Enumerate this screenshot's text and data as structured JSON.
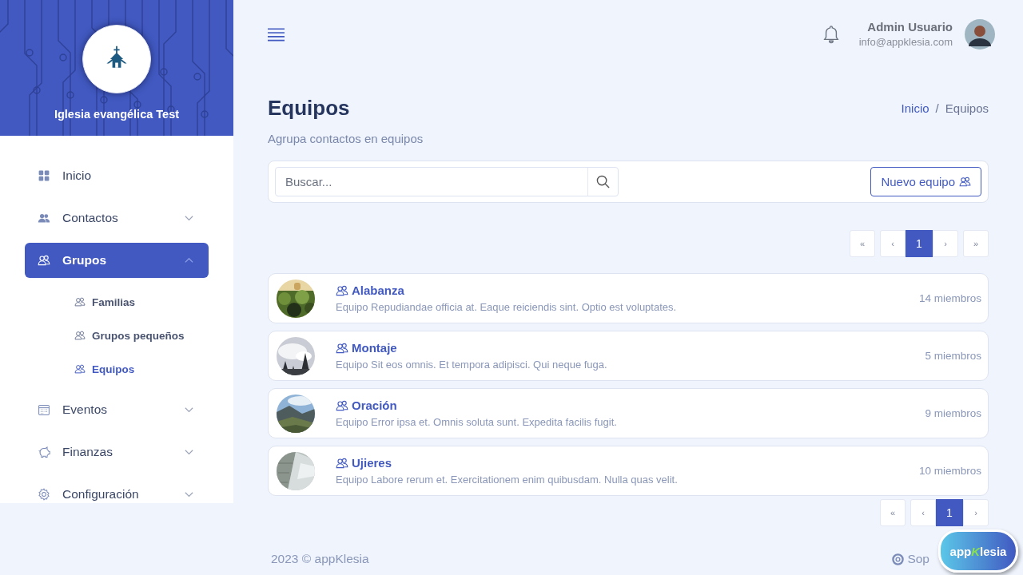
{
  "sidebar": {
    "church_name": "Iglesia evangélica Test",
    "items": [
      {
        "label": "Inicio",
        "selected": false
      },
      {
        "label": "Contactos",
        "selected": false,
        "expanded": false
      },
      {
        "label": "Grupos",
        "selected": true,
        "expanded": true,
        "children": [
          {
            "label": "Familias",
            "selected": false
          },
          {
            "label": "Grupos pequeños",
            "selected": false
          },
          {
            "label": "Equipos",
            "selected": true
          }
        ]
      },
      {
        "label": "Eventos",
        "selected": false,
        "expanded": false
      },
      {
        "label": "Finanzas",
        "selected": false,
        "expanded": false
      },
      {
        "label": "Configuración",
        "selected": false,
        "expanded": false
      }
    ]
  },
  "header": {
    "user_name": "Admin Usuario",
    "user_email": "info@appklesia.com"
  },
  "page": {
    "title": "Equipos",
    "subtitle": "Agrupa contactos en equipos",
    "breadcrumb": [
      {
        "label": "Inicio",
        "selected": false
      },
      {
        "label": "Equipos",
        "selected": true
      }
    ],
    "breadcrumb_separator": "/"
  },
  "search": {
    "placeholder": "Buscar..."
  },
  "new_button": "Nuevo equipo",
  "pagination_top": [
    {
      "label": "«",
      "selected": false
    },
    {
      "label": "‹",
      "selected": false
    },
    {
      "label": "1",
      "selected": true
    },
    {
      "label": "›",
      "selected": false
    },
    {
      "label": "»",
      "selected": false
    }
  ],
  "teams": [
    {
      "name": "Alabanza",
      "description": "Equipo Repudiandae officia at. Eaque reiciendis sint. Optio est voluptates.",
      "members": "14 miembros"
    },
    {
      "name": "Montaje",
      "description": "Equipo Sit eos omnis. Et tempora adipisci. Qui neque fuga.",
      "members": "5 miembros"
    },
    {
      "name": "Oración",
      "description": "Equipo Error ipsa et. Omnis soluta sunt. Expedita facilis fugit.",
      "members": "9 miembros"
    },
    {
      "name": "Ujieres",
      "description": "Equipo Labore rerum et. Exercitationem enim quibusdam. Nulla quas velit.",
      "members": "10 miembros"
    }
  ],
  "pagination_bottom": [
    {
      "label": "«",
      "selected": false
    },
    {
      "label": "‹",
      "selected": false
    },
    {
      "label": "1",
      "selected": true
    },
    {
      "label": "›",
      "selected": false
    }
  ],
  "footer": {
    "copyright": "2023 © appKlesia",
    "support": "Sop"
  },
  "badge": {
    "before": "app",
    "highlight": "K",
    "after": "lesia"
  }
}
